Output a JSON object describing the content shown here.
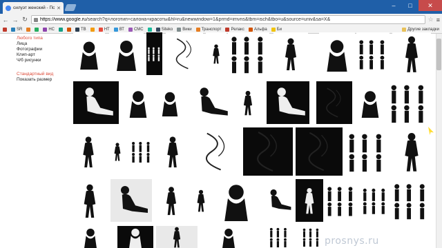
{
  "browser": {
    "tab_title": "силуэт женский - По",
    "url_host": "https://www.google.ru",
    "url_rest": "/search?q=логотип+салона+красоты&hl=ru&newwindow=1&prmd=imvns&tbm=isch&tbo=u&source=univ&sa=X&",
    "bookmarks": [
      {
        "label": "",
        "color": "#c0392b"
      },
      {
        "label": "SR",
        "color": "#2980b9"
      },
      {
        "label": "",
        "color": "#e67e22"
      },
      {
        "label": "",
        "color": "#27ae60"
      },
      {
        "label": "НС",
        "color": "#8e44ad"
      },
      {
        "label": "",
        "color": "#16a085"
      },
      {
        "label": "",
        "color": "#d35400"
      },
      {
        "label": "TB",
        "color": "#2c3e50"
      },
      {
        "label": "",
        "color": "#f39c12"
      },
      {
        "label": "НТ",
        "color": "#e74c3c"
      },
      {
        "label": "ВТ",
        "color": "#3498db"
      },
      {
        "label": "СМС",
        "color": "#9b59b6"
      },
      {
        "label": "",
        "color": "#1abc9c"
      },
      {
        "label": "Siteko",
        "color": "#34495e"
      },
      {
        "label": "Вики",
        "color": "#7f8c8d"
      },
      {
        "label": "Транспорт",
        "color": "#e67e22"
      },
      {
        "label": "Релакс",
        "color": "#c0392b"
      },
      {
        "label": "Альфа",
        "color": "#d35400"
      },
      {
        "label": "Би",
        "color": "#f1c40f"
      }
    ],
    "other_bookmarks": "Другие закладки"
  },
  "filters": {
    "type_header": "Любого типа",
    "type_items": [
      "Лица",
      "Фотографии",
      "Клип-арт",
      "Ч/б рисунки"
    ],
    "view_header": "Стандартный вид",
    "view_items": [
      "Показать размер"
    ]
  },
  "watermark": "prosnys.ru"
}
